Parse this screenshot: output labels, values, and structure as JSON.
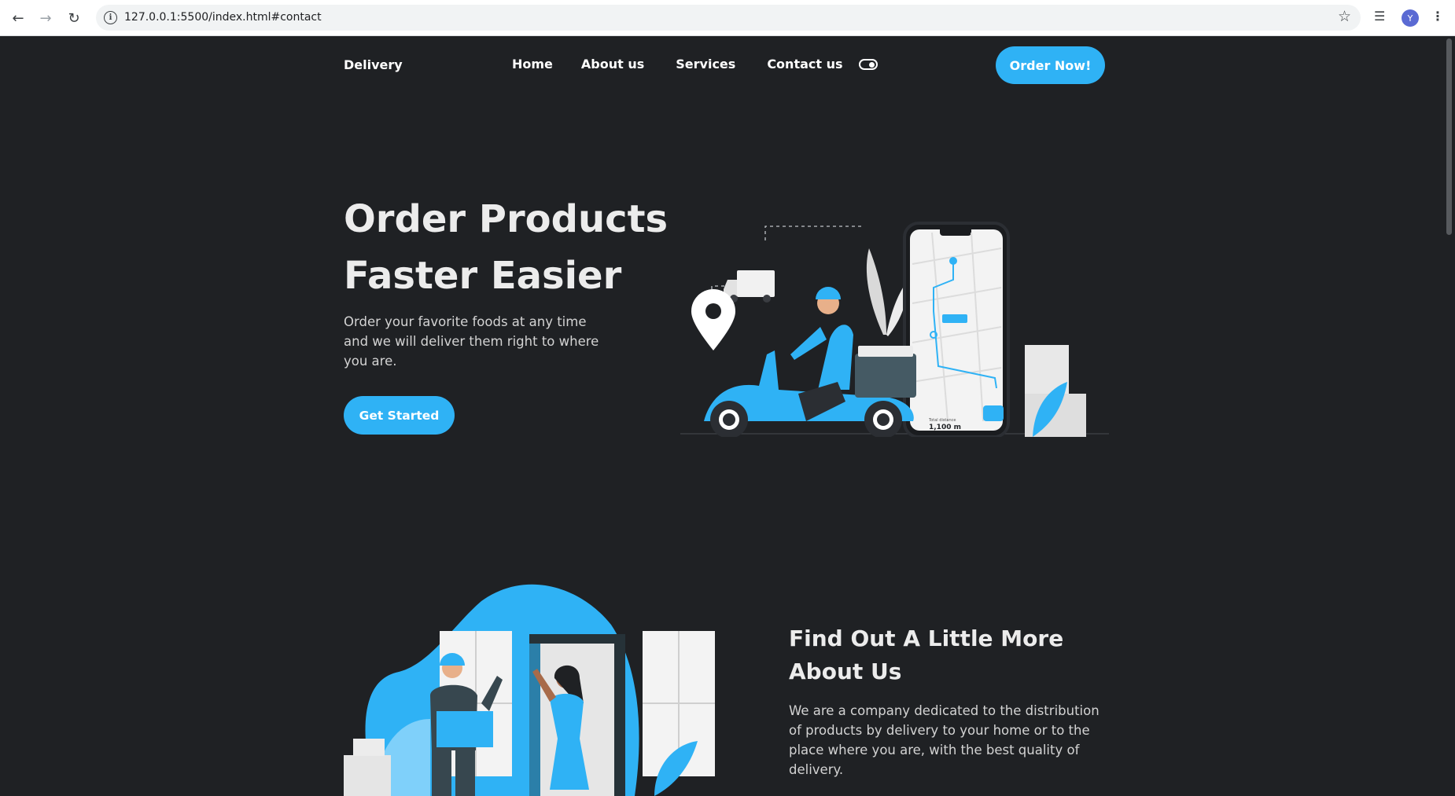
{
  "browser": {
    "url": "127.0.0.1:5500/index.html#contact",
    "avatar_letter": "Y"
  },
  "navbar": {
    "logo": "Delivery",
    "links": [
      "Home",
      "About us",
      "Services",
      "Contact us"
    ],
    "order_button": "Order Now!"
  },
  "hero": {
    "title_line1": "Order Products",
    "title_line2": "Faster Easier",
    "description": "Order your favorite foods at any time and we will deliver them right to where you are.",
    "cta": "Get Started",
    "phone_distance_label": "Total distance",
    "phone_distance_value": "1,100 m"
  },
  "about": {
    "title": "Find Out A Little More About Us",
    "description": "We are a company dedicated to the distribution of products by delivery to your home or to the place where you are, with the best quality of delivery."
  },
  "colors": {
    "accent": "#2fb2f5",
    "background": "#1f2124",
    "text": "#ececec"
  }
}
